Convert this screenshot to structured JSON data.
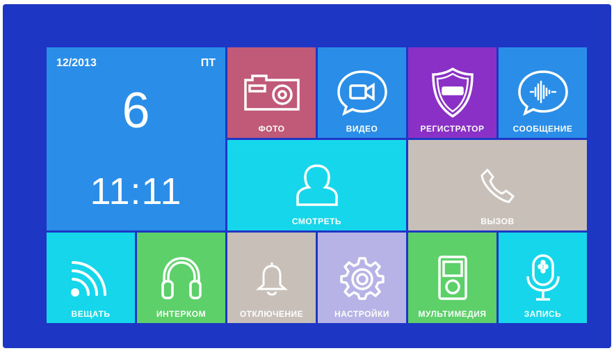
{
  "clock": {
    "date": "12/2013",
    "weekday": "ПТ",
    "day": "6",
    "time": "11:11"
  },
  "tiles": {
    "photo": {
      "label": "ФОТО",
      "icon": "camera-icon",
      "color": "#c15a78"
    },
    "video": {
      "label": "ВИДЕО",
      "icon": "video-camera-icon",
      "color": "#2a8ee8"
    },
    "recorder": {
      "label": "РЕГИСТРАТОР",
      "icon": "shield-icon",
      "color": "#8a30c6"
    },
    "message": {
      "label": "СООБЩЕНИЕ",
      "icon": "voice-message-icon",
      "color": "#2a8ee8"
    },
    "watch": {
      "label": "СМОТРЕТЬ",
      "icon": "user-icon",
      "color": "#16d6ec"
    },
    "call": {
      "label": "ВЫЗОВ",
      "icon": "phone-icon",
      "color": "#c8c0b8"
    },
    "broadcast": {
      "label": "ВЕЩАТЬ",
      "icon": "broadcast-icon",
      "color": "#16d6ec"
    },
    "intercom": {
      "label": "ИНТЕРКОМ",
      "icon": "headphones-icon",
      "color": "#5dd06a"
    },
    "disable": {
      "label": "ОТКЛЮЧЕНИЕ",
      "icon": "bell-icon",
      "color": "#c8c0b8"
    },
    "settings": {
      "label": "НАСТРОЙКИ",
      "icon": "gear-icon",
      "color": "#b7b3e6"
    },
    "multimedia": {
      "label": "МУЛЬТИМЕДИЯ",
      "icon": "media-player-icon",
      "color": "#5dd06a"
    },
    "record": {
      "label": "ЗАПИСЬ",
      "icon": "microphone-icon",
      "color": "#16d6ec"
    }
  }
}
